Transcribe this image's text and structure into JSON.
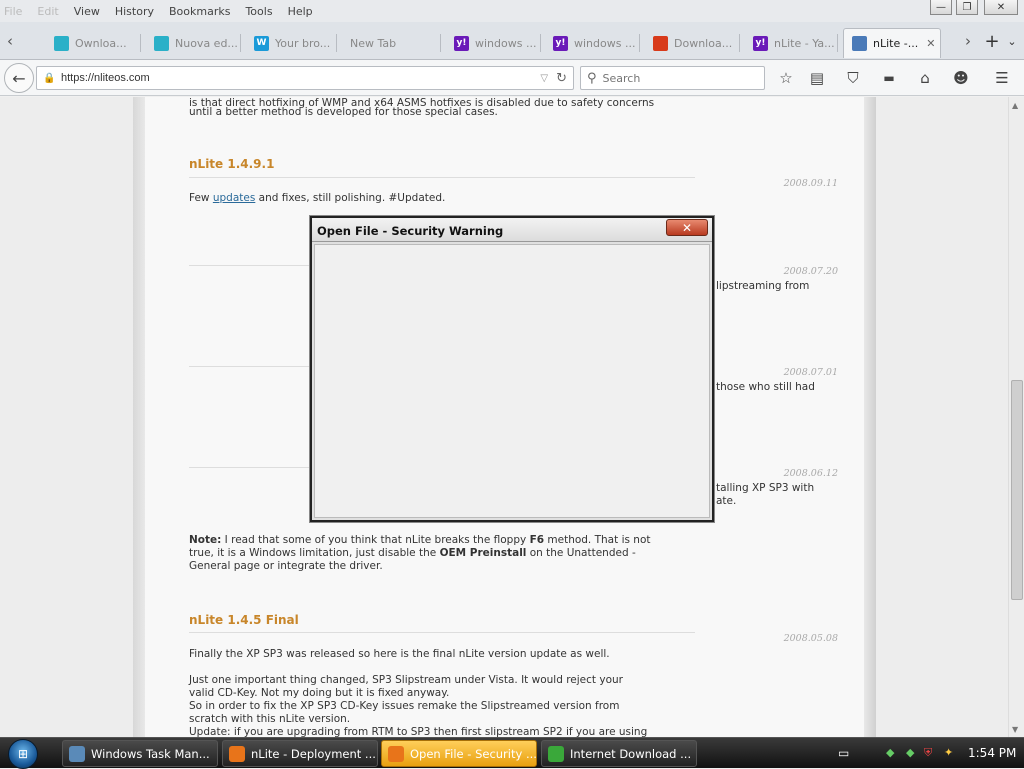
{
  "menu": {
    "items": [
      {
        "label": "File",
        "faded": true
      },
      {
        "label": "Edit",
        "faded": true
      },
      {
        "label": "View",
        "faded": false
      },
      {
        "label": "History",
        "faded": false
      },
      {
        "label": "Bookmarks",
        "faded": false
      },
      {
        "label": "Tools",
        "faded": false
      },
      {
        "label": "Help",
        "faded": false
      }
    ]
  },
  "window_controls": {
    "minimize": "—",
    "restore": "❐",
    "close": "✕"
  },
  "tabs": [
    {
      "label": "Ownloa...",
      "icon": "download-icon",
      "color": "#2ab0c8"
    },
    {
      "label": "Nuova ed...",
      "icon": "edit-icon",
      "color": "#2ab0c8"
    },
    {
      "label": "Your bro...",
      "icon": "w-icon",
      "color": "#1a9ad8"
    },
    {
      "label": "New Tab",
      "icon": "",
      "color": ""
    },
    {
      "label": "windows ...",
      "icon": "yahoo-icon",
      "color": "#6a1ab8"
    },
    {
      "label": "windows ...",
      "icon": "yahoo-icon",
      "color": "#6a1ab8"
    },
    {
      "label": "Downloa...",
      "icon": "microsoft-icon",
      "color": "#d83a1a"
    },
    {
      "label": "nLite - Ya...",
      "icon": "yahoo-icon",
      "color": "#6a1ab8"
    },
    {
      "label": "nLite -...",
      "icon": "page-icon",
      "color": "#4a7ab8",
      "active": true
    }
  ],
  "tab_close": "✕",
  "nav": {
    "url": "https://nliteos.com",
    "search_placeholder": "Search"
  },
  "page": {
    "top_lines": [
      "is that direct hotfixing of WMP and x64 ASMS hotfixes is disabled due to safety concerns",
      "until a better method is developed for those special cases."
    ],
    "post1": {
      "title": "nLite 1.4.9.1",
      "date": "2008.09.11",
      "text_before": "Few ",
      "link": "updates",
      "text_after": " and fixes, still polishing. #Updated."
    },
    "date2": "2008.07.20",
    "partial2": "lipstreaming from",
    "date3": "2008.07.01",
    "partial3": "those who still had",
    "date4": "2008.06.12",
    "partial4a": "talling XP SP3 with",
    "partial4b": "ate.",
    "note": {
      "bold": "Note:",
      "p1": " I read that some of you think that nLite breaks the floppy ",
      "f6": "F6",
      "p2": " method. That is not",
      "line2a": "true, it is a Windows limitation, just disable the ",
      "oem": "OEM Preinstall",
      "line2b": " on the Unattended -",
      "line3": "General page or integrate the driver."
    },
    "post_final": {
      "title": "nLite 1.4.5 Final",
      "date": "2008.05.08",
      "lines": [
        "Finally the XP SP3 was released so here is the final nLite version update as well.",
        "",
        "Just one important thing changed, SP3 Slipstream under Vista. It would reject your",
        "valid CD-Key. Not my doing but it is fixed anyway.",
        "So in order to fix the XP SP3 CD-Key issues remake the Slipstreamed version from",
        "scratch with this nLite version.",
        "Update: if you are upgrading from RTM to SP3 then first slipstream SP2 if you are using"
      ]
    }
  },
  "dialog": {
    "title": "Open File - Security Warning",
    "close": "✕"
  },
  "taskbar": {
    "items": [
      {
        "label": "Windows Task Man...",
        "icon": "task-manager-icon",
        "color": "#5a8ab8"
      },
      {
        "label": "nLite - Deployment ...",
        "icon": "firefox-icon",
        "color": "#e8741a"
      },
      {
        "label": "Open File - Security ...",
        "icon": "firefox-icon",
        "color": "#e8741a",
        "active": true
      },
      {
        "label": "Internet Download ...",
        "icon": "idm-icon",
        "color": "#3aa83a"
      }
    ],
    "clock": "1:54 PM"
  }
}
